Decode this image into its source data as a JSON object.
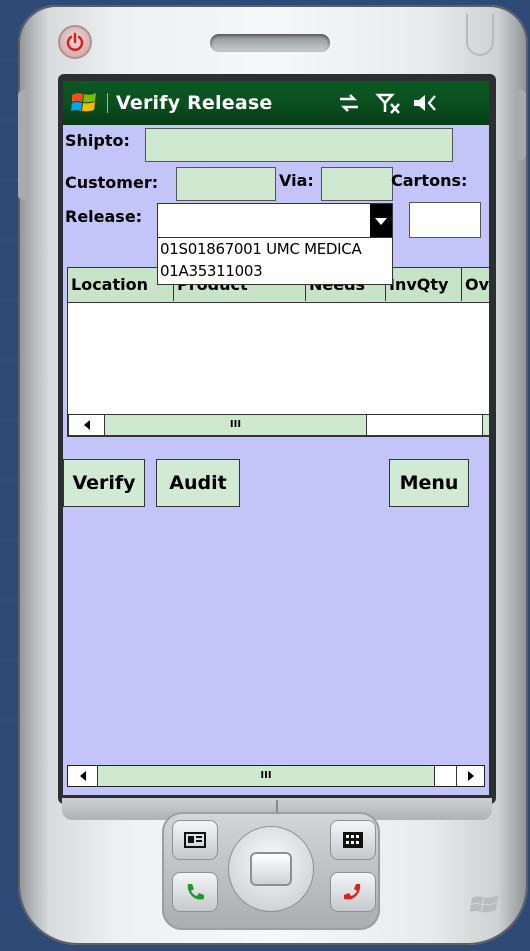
{
  "window": {
    "title": "Verify Release"
  },
  "form": {
    "shipto_label": "Shipto:",
    "customer_label": "Customer:",
    "via_label": "Via:",
    "cartons_label": "Cartons:",
    "release_label": "Release:",
    "shipto_value": "",
    "customer_value": "",
    "via_value": "",
    "cartons_value": "",
    "release_value": ""
  },
  "release_options": [
    "01S01867001 UMC MEDICA",
    "01A35311003"
  ],
  "grid": {
    "columns": [
      "Location",
      "Product",
      "Needs",
      "InvQty",
      "Ov"
    ],
    "rows": []
  },
  "buttons": {
    "verify": "Verify",
    "audit": "Audit",
    "menu": "Menu"
  },
  "scroll": {
    "thumb_glyph": "III"
  },
  "colors": {
    "titlebar": "#0b5520",
    "screen_bg": "#c3c5f8",
    "field_bg": "#cfe8d0"
  },
  "icons": {
    "start": "windows-flag-icon",
    "connectivity": "sync-arrows-icon",
    "signal": "antenna-off-icon",
    "volume": "speaker-icon"
  }
}
